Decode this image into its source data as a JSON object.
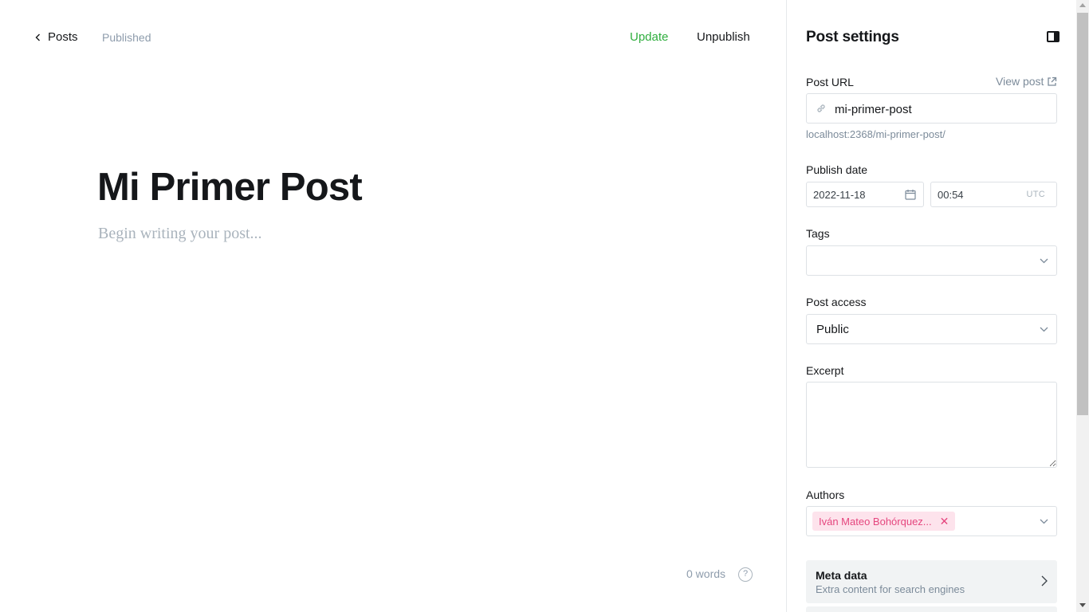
{
  "topbar": {
    "back_label": "Posts",
    "status": "Published",
    "update_label": "Update",
    "unpublish_label": "Unpublish"
  },
  "editor": {
    "title": "Mi Primer Post",
    "body_placeholder": "Begin writing your post...",
    "word_count": "0 words",
    "help_glyph": "?"
  },
  "settings": {
    "title": "Post settings",
    "post_url": {
      "label": "Post URL",
      "view_post": "View post",
      "value": "mi-primer-post",
      "hint": "localhost:2368/mi-primer-post/"
    },
    "publish_date": {
      "label": "Publish date",
      "date": "2022-11-18",
      "time": "00:54",
      "timezone": "UTC"
    },
    "tags": {
      "label": "Tags"
    },
    "access": {
      "label": "Post access",
      "value": "Public"
    },
    "excerpt": {
      "label": "Excerpt",
      "value": ""
    },
    "authors": {
      "label": "Authors",
      "chips": [
        {
          "name": "Iván Mateo Bohórquez...",
          "remove_glyph": "✕"
        }
      ]
    },
    "meta": {
      "title": "Meta data",
      "subtitle": "Extra content for search engines"
    }
  },
  "colors": {
    "accent_green": "#2fae3e",
    "author_chip_bg": "#fde3ec",
    "author_chip_text": "#e5467e",
    "muted_text": "#7c8b9a"
  },
  "icons": {
    "back": "chevron-left-icon",
    "panel_toggle": "sidebar-toggle-icon",
    "external": "external-link-icon",
    "link": "link-icon",
    "calendar": "calendar-icon",
    "dropdown": "chevron-down-icon",
    "arrow": "chevron-right-icon",
    "help": "question-circle-icon"
  }
}
